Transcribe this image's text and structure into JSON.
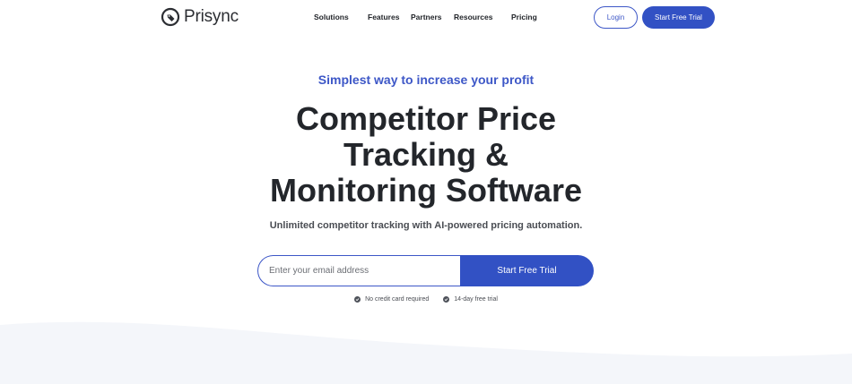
{
  "brand": {
    "name": "Prisync"
  },
  "nav": {
    "links": [
      "Solutions",
      "Features",
      "Partners",
      "Resources",
      "Pricing"
    ],
    "login_label": "Login",
    "trial_label": "Start Free Trial"
  },
  "hero": {
    "tagline": "Simplest way to increase your profit",
    "headline_lines": [
      "Competitor Price",
      "Tracking &",
      "Monitoring Software"
    ],
    "subhead": "Unlimited competitor tracking with AI-powered pricing automation.",
    "email_placeholder": "Enter your email address",
    "submit_label": "Start Free Trial",
    "perks": [
      "No credit card required",
      "14-day free trial"
    ]
  },
  "colors": {
    "accent": "#3251c4",
    "accent_text": "#3d57c7",
    "heading": "#23262b",
    "wave_bg": "#f4f6fa"
  },
  "icons": {
    "logo": "price-tag-icon",
    "perk": "check-circle-icon"
  }
}
